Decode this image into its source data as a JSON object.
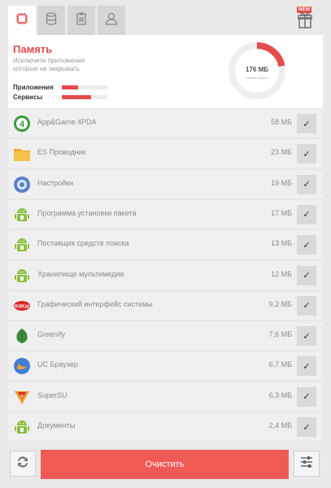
{
  "tabs": [
    {
      "name": "cpu",
      "icon": "chip-icon",
      "active": true
    },
    {
      "name": "storage",
      "icon": "database-icon",
      "active": false
    },
    {
      "name": "clipboard",
      "icon": "clipboard-icon",
      "active": false
    },
    {
      "name": "profile",
      "icon": "user-icon",
      "active": false
    }
  ],
  "gift": {
    "badge": "NEW",
    "icon": "gift-icon"
  },
  "memory": {
    "title": "Память",
    "subtitle": "Исключите приложения которые не закрывать",
    "legend": [
      {
        "label": "Приложения",
        "fill": 0.35
      },
      {
        "label": "Сервисы",
        "fill": 0.65
      }
    ],
    "donut": {
      "value": "176 МБ",
      "label": "занято памяти",
      "fraction": 0.22
    }
  },
  "apps": [
    {
      "name": "App&Game 4PDA",
      "size": "58 МБ",
      "icon": "4pda-icon"
    },
    {
      "name": "ES Проводник",
      "size": "23 МБ",
      "icon": "folder-icon"
    },
    {
      "name": "Настройки",
      "size": "19 МБ",
      "icon": "settings-gear-icon"
    },
    {
      "name": "Программа установки пакета",
      "size": "17 МБ",
      "icon": "android-icon"
    },
    {
      "name": "Поставщик средств поиска",
      "size": "13 МБ",
      "icon": "android-icon"
    },
    {
      "name": "Хранилище мультимедиа",
      "size": "12 МБ",
      "icon": "android-icon"
    },
    {
      "name": "Графический интерфейс системы",
      "size": "9,2 МБ",
      "icon": "kitkat-icon"
    },
    {
      "name": "Greenify",
      "size": "7,6 МБ",
      "icon": "leaf-icon"
    },
    {
      "name": "UC Браузер",
      "size": "6,7 МБ",
      "icon": "uc-browser-icon"
    },
    {
      "name": "SuperSU",
      "size": "6,3 МБ",
      "icon": "supersu-icon"
    },
    {
      "name": "Документы",
      "size": "2,4 МБ",
      "icon": "android-icon"
    }
  ],
  "bottom": {
    "clean_label": "Очистить",
    "refresh_icon": "refresh-icon",
    "settings_icon": "sliders-icon"
  },
  "colors": {
    "accent": "#e64a4a",
    "button": "#f05a55",
    "background": "#e9e9e9"
  }
}
